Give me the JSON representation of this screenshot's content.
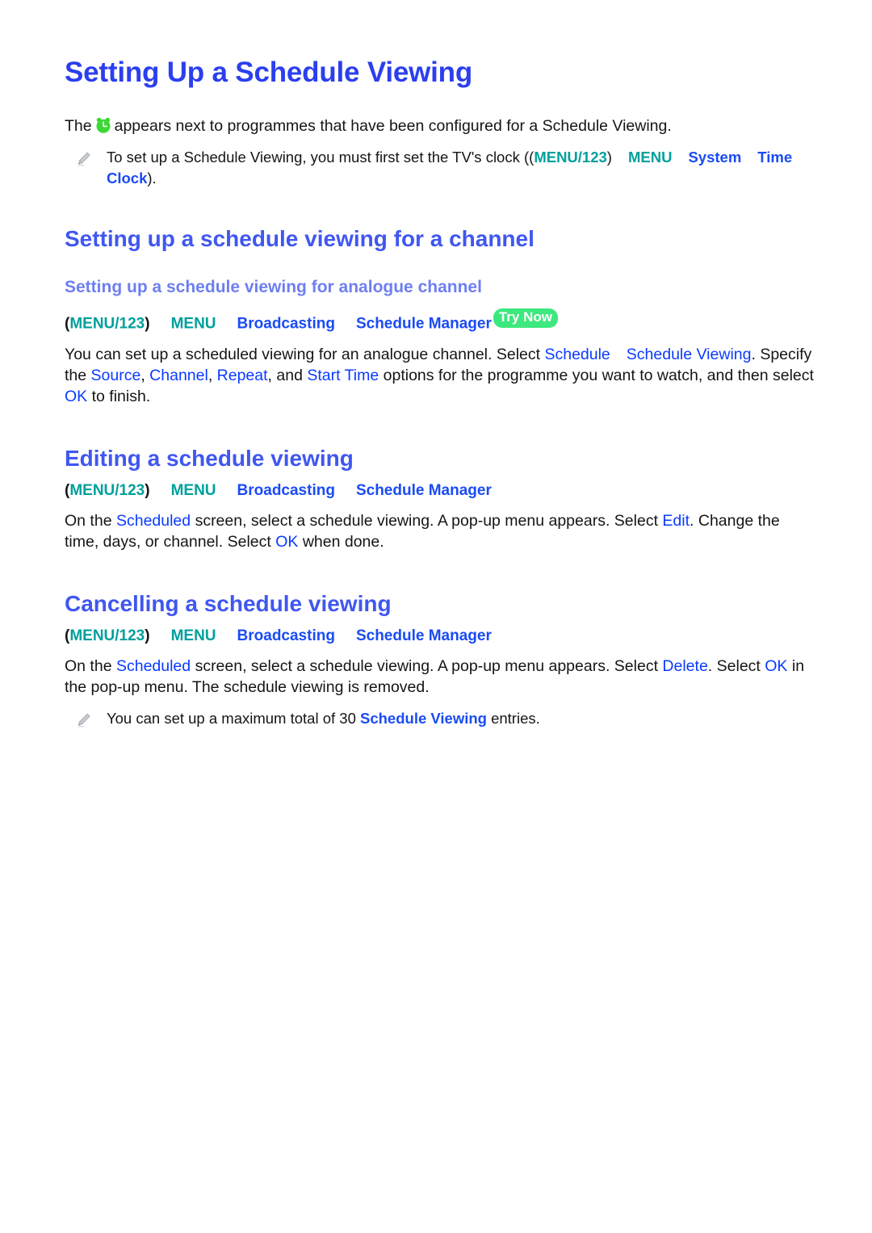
{
  "page": {
    "title": "Setting Up a Schedule Viewing"
  },
  "intro": {
    "before_icon": "The",
    "icon": "alarm-clock-icon",
    "after_icon": "appears next to programmes that have been configured for a Schedule Viewing."
  },
  "intro_note": {
    "icon": "pencil-icon",
    "text_before": "To set up a Schedule Viewing, you must first set the TV's clock ((",
    "menu123": "MENU/123",
    "close_paren": ")",
    "menu": "MENU",
    "system": "System",
    "time": "Time",
    "clock": "Clock",
    "text_after": ")."
  },
  "section_channel": {
    "heading": "Setting up a schedule viewing for a channel",
    "subheading": "Setting up a schedule viewing for analogue channel",
    "path": {
      "open_paren": "(",
      "menu123": "MENU/123",
      "close_paren": ")",
      "menu": "MENU",
      "broadcasting": "Broadcasting",
      "schedule_manager": "Schedule Manager",
      "try_now": "Try Now"
    },
    "body": {
      "p1_a": "You can set up a scheduled viewing for an analogue channel. Select",
      "p1_kw1": "Schedule",
      "p1_kw2": "Schedule Viewing",
      "p1_b": ".",
      "p2_a": "Specify the",
      "p2_kw1": "Source",
      "p2_sep1": ",",
      "p2_kw2": "Channel",
      "p2_sep2": ",",
      "p2_kw3": "Repeat",
      "p2_sep3": ", and",
      "p2_kw4": "Start Time",
      "p2_b": "options for the programme you want to watch,",
      "p3_a": "and then select",
      "p3_kw": "OK",
      "p3_b": "to finish."
    }
  },
  "section_editing": {
    "heading": "Editing a schedule viewing",
    "path": {
      "open_paren": "(",
      "menu123": "MENU/123",
      "close_paren": ")",
      "menu": "MENU",
      "broadcasting": "Broadcasting",
      "schedule_manager": "Schedule Manager"
    },
    "body": {
      "a": "On the",
      "kw1": "Scheduled",
      "b": "screen, select a schedule viewing. A pop-up menu appears. Select",
      "kw2": "Edit",
      "c": ". Change the time, days, or channel. Select",
      "kw3": "OK",
      "d": "when done."
    }
  },
  "section_cancelling": {
    "heading": "Cancelling a schedule viewing",
    "path": {
      "open_paren": "(",
      "menu123": "MENU/123",
      "close_paren": ")",
      "menu": "MENU",
      "broadcasting": "Broadcasting",
      "schedule_manager": "Schedule Manager"
    },
    "body": {
      "a": "On the",
      "kw1": "Scheduled",
      "b": "screen, select a schedule viewing. A pop-up menu appears. Select",
      "kw2": "Delete",
      "c": ". Select",
      "kw3": "OK",
      "d": "in the pop-up menu. The schedule viewing is removed."
    },
    "note": {
      "icon": "pencil-icon",
      "a": "You can set up a maximum total of 30",
      "kw": "Schedule Viewing",
      "b": "entries."
    }
  },
  "colors": {
    "title_blue": "#2B3FEE",
    "heading_blue": "#4057F0",
    "subheading_blue": "#6E7FF0",
    "keyword_blue": "#0A3BFF",
    "path_teal": "#00A09C",
    "try_now_green": "#3DE87E",
    "clock_green": "#3DD835",
    "body_text": "#151515"
  }
}
